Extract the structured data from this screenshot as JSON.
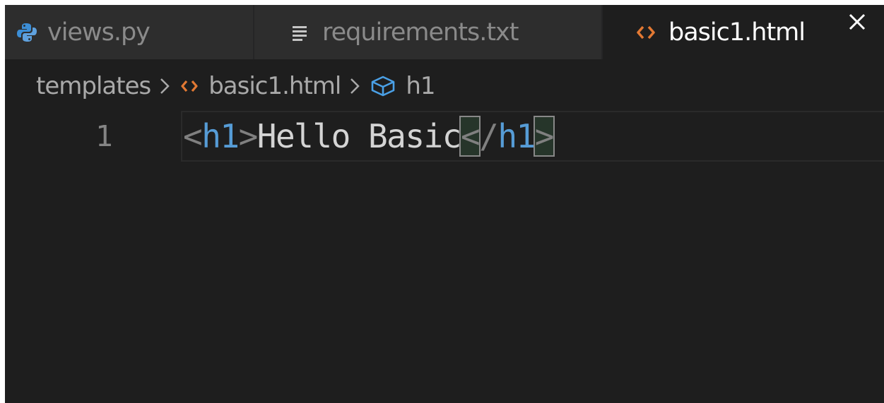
{
  "tabs": [
    {
      "label": "views.py",
      "icon": "python-icon",
      "active": false
    },
    {
      "label": "requirements.txt",
      "icon": "text-file-icon",
      "active": false
    },
    {
      "label": "basic1.html",
      "icon": "html-code-icon",
      "active": true
    }
  ],
  "breadcrumb": {
    "folder": "templates",
    "file": "basic1.html",
    "symbol": "h1"
  },
  "editor": {
    "line_number": "1",
    "tokens": {
      "open_lt": "<",
      "open_tag": "h1",
      "open_gt": ">",
      "text": "Hello Basic",
      "close_lt": "<",
      "close_slash": "/",
      "close_tag": "h1",
      "close_gt": ">"
    }
  },
  "colors": {
    "editor_bg": "#1e1e1e",
    "inactive_tab_bg": "#2d2d2d",
    "tag_blue": "#569cd6",
    "bracket_gray": "#808080",
    "text": "#d4d4d4",
    "html_icon_orange": "#e37933",
    "python_icon_blue": "#3c8ed6"
  }
}
